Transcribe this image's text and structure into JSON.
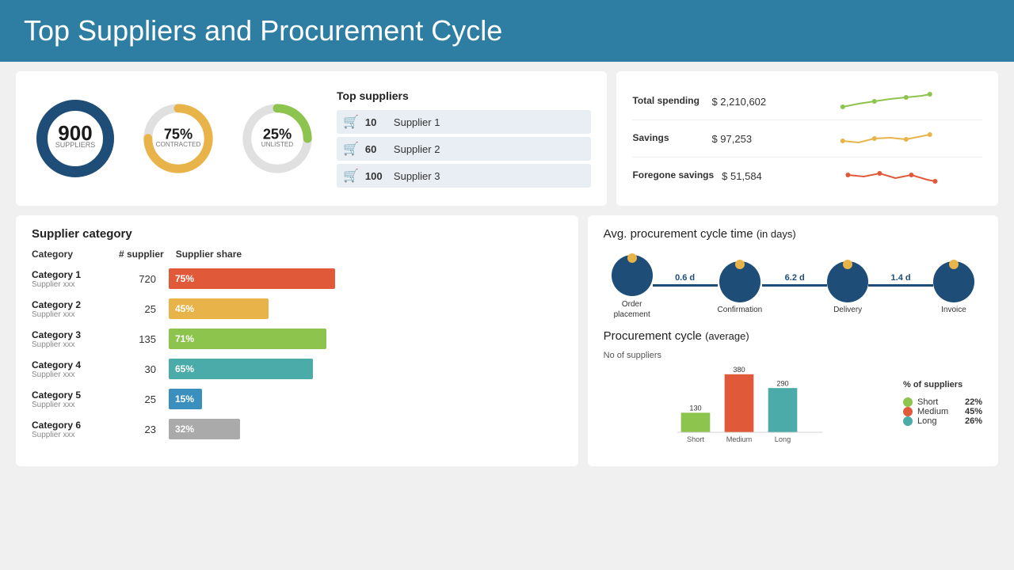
{
  "header": {
    "title": "Top Suppliers and Procurement Cycle"
  },
  "top_left": {
    "donut1": {
      "value": "900",
      "label": "SUPPLIERS",
      "pct": 100,
      "color": "#1e4d78",
      "bg": "#e0e0e0"
    },
    "donut2": {
      "value": "75%",
      "label": "CONTRACTED",
      "pct": 75,
      "color": "#e8b44a",
      "bg": "#e0e0e0"
    },
    "donut3": {
      "value": "25%",
      "label": "UNLISTED",
      "pct": 25,
      "color": "#8dc44e",
      "bg": "#e0e0e0"
    },
    "top_suppliers_title": "Top suppliers",
    "suppliers": [
      {
        "icon": "🛒",
        "num": "10",
        "name": "Supplier 1"
      },
      {
        "icon": "🛒",
        "num": "60",
        "name": "Supplier 2"
      },
      {
        "icon": "🛒",
        "num": "100",
        "name": "Supplier 3"
      }
    ]
  },
  "top_right": {
    "rows": [
      {
        "label": "Total spending",
        "value": "$ 2,210,602",
        "color": "#8dc44e"
      },
      {
        "label": "Savings",
        "value": "$ 97,253",
        "color": "#e8b44a"
      },
      {
        "label": "Foregone savings",
        "value": "$ 51,584",
        "color": "#e05a3a"
      }
    ]
  },
  "supplier_category": {
    "title": "Supplier category",
    "col1": "Category",
    "col2": "# supplier",
    "col3": "Supplier share",
    "rows": [
      {
        "name": "Category 1",
        "sub": "Supplier xxx",
        "num": "720",
        "pct": 75,
        "pct_label": "75%",
        "color": "#e05a3a"
      },
      {
        "name": "Category 2",
        "sub": "Supplier xxx",
        "num": "25",
        "pct": 45,
        "pct_label": "45%",
        "color": "#e8b44a"
      },
      {
        "name": "Category 3",
        "sub": "Supplier xxx",
        "num": "135",
        "pct": 71,
        "pct_label": "71%",
        "color": "#8dc44e"
      },
      {
        "name": "Category 4",
        "sub": "Supplier xxx",
        "num": "30",
        "pct": 65,
        "pct_label": "65%",
        "color": "#4aaba8"
      },
      {
        "name": "Category 5",
        "sub": "Supplier xxx",
        "num": "25",
        "pct": 15,
        "pct_label": "15%",
        "color": "#3a8fbf"
      },
      {
        "name": "Category 6",
        "sub": "Supplier xxx",
        "num": "23",
        "pct": 32,
        "pct_label": "32%",
        "color": "#aaaaaa"
      }
    ]
  },
  "procurement_timeline": {
    "title": "Avg. procurement cycle time",
    "title_suffix": " (in days)",
    "steps": [
      {
        "label": "Order\nplacement",
        "value": ""
      },
      {
        "label": "",
        "value": "0.6 d"
      },
      {
        "label": "Confirmation",
        "value": ""
      },
      {
        "label": "",
        "value": "6.2 d"
      },
      {
        "label": "Delivery",
        "value": ""
      },
      {
        "label": "",
        "value": "1.4 d"
      },
      {
        "label": "Invoice",
        "value": ""
      }
    ]
  },
  "procurement_cycle": {
    "title": "Procurement cycle",
    "title_suffix": " (average)",
    "bar_label": "No of suppliers",
    "bars": [
      {
        "label": "Short",
        "value": 130,
        "color": "#8dc44e"
      },
      {
        "label": "Medium",
        "value": 380,
        "color": "#e05a3a"
      },
      {
        "label": "Long",
        "value": 290,
        "color": "#4aaba8"
      }
    ],
    "legend_title": "% of suppliers",
    "legend": [
      {
        "label": "Short",
        "pct": "22%",
        "color": "#8dc44e"
      },
      {
        "label": "Medium",
        "pct": "45%",
        "color": "#e05a3a"
      },
      {
        "label": "Long",
        "pct": "26%",
        "color": "#4aaba8"
      }
    ]
  }
}
